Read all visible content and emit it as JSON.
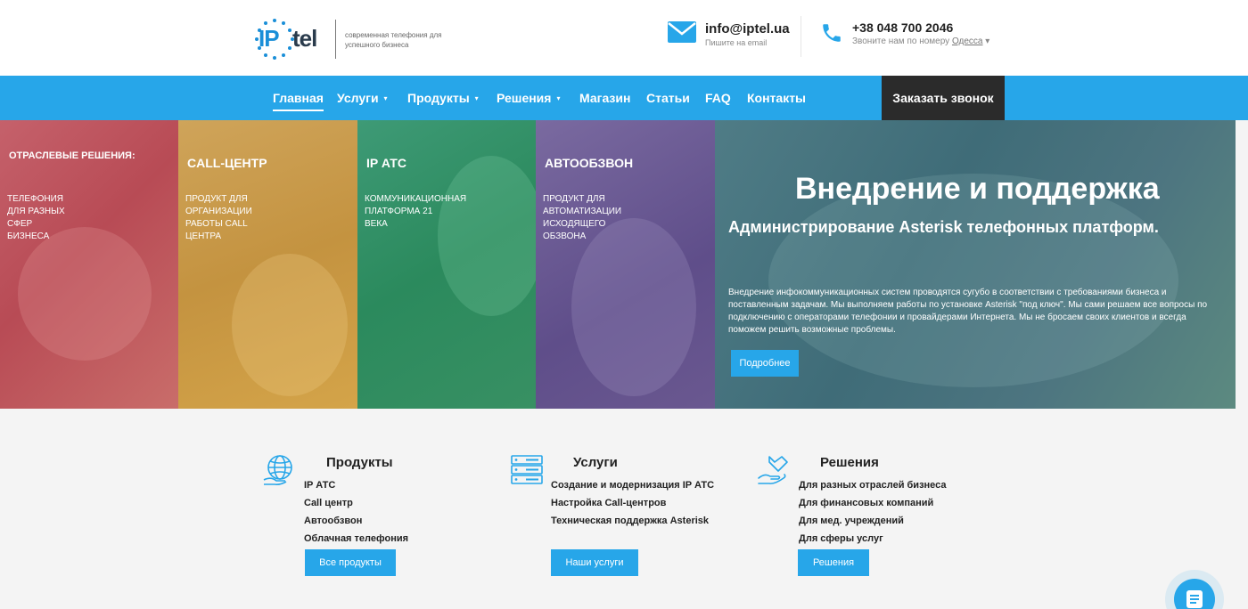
{
  "header": {
    "logo": {
      "ip": "IP",
      "tel": "tel",
      "tagline": "современная телефония для успешного бизнеса"
    },
    "email": {
      "address": "info@iptel.ua",
      "caption": "Пишите на email"
    },
    "phone": {
      "number": "+38 048 700 2046",
      "caption": "Звоните нам по номеру",
      "city": "Одесса"
    }
  },
  "nav": {
    "items": [
      {
        "label": "Главная",
        "active": true
      },
      {
        "label": "Услуги",
        "dropdown": true
      },
      {
        "label": "Продукты",
        "dropdown": true
      },
      {
        "label": "Решения",
        "dropdown": true
      },
      {
        "label": "Магазин"
      },
      {
        "label": "Статьи"
      },
      {
        "label": "FAQ"
      },
      {
        "label": "Контакты"
      }
    ],
    "callback": "Заказать звонок",
    "caret": "▾"
  },
  "hero": {
    "panels": [
      {
        "title": "ОТРАСЛЕВЫЕ РЕШЕНИЯ:",
        "text": "ТЕЛЕФОНИЯ ДЛЯ РАЗНЫХ СФЕР БИЗНЕСА"
      },
      {
        "title": "CALL-ЦЕНТР",
        "text": "ПРОДУКТ ДЛЯ ОРГАНИЗАЦИИ РАБОТЫ CALL ЦЕНТРА"
      },
      {
        "title": "IP АТС",
        "text": "КОММУНИКАЦИОННАЯ ПЛАТФОРМА 21 ВЕКА"
      },
      {
        "title": "АВТООБЗВОН",
        "text": "ПРОДУКТ ДЛЯ АВТОМАТИЗАЦИИ ИСХОДЯЩЕГО ОБЗВОНА"
      }
    ],
    "main": {
      "title": "Внедрение и поддержка",
      "subtitle": "Администрирование Asterisk телефонных платформ.",
      "description": "Внедрение инфокоммуникационных систем проводятся сугубо в соответствии с требованиями бизнеса и поставленным задачам. Мы выполняем работы по установке Asterisk \"под ключ\". Мы сами решаем все вопросы по подключению с операторами телефонии и провайдерами Интернета. Мы не бросаем своих клиентов и всегда поможем решить возможные проблемы.",
      "button": "Подробнее"
    },
    "colors": {
      "panel1": "#c0565f",
      "panel2": "#c99a48",
      "panel3": "#2f8c62",
      "panel4": "#66558f",
      "panel5": "#467480"
    }
  },
  "features": [
    {
      "icon": "globe-hand-icon",
      "title": "Продукты",
      "items": [
        "IP АТС",
        "Call центр",
        "Автообзвон",
        "Облачная телефония"
      ],
      "button": "Все продукты"
    },
    {
      "icon": "server-icon",
      "title": "Услуги",
      "items": [
        "Создание и модернизация IP АТС",
        "Настройка Call-центров",
        "Техническая поддержка Asterisk"
      ],
      "button": "Наши услуги"
    },
    {
      "icon": "hands-icon",
      "title": "Решения",
      "items": [
        "Для разных отраслей бизнеса",
        "Для финансовых компаний",
        "Для мед. учреждений",
        "Для сферы услуг"
      ],
      "button": "Решения"
    }
  ],
  "colors": {
    "accent": "#27a6e9",
    "dark": "#2b2b2b"
  }
}
